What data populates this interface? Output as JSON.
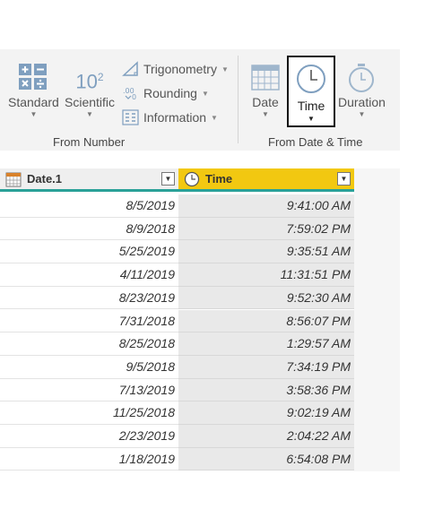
{
  "ribbon": {
    "from_number": {
      "group_label": "From Number",
      "standard_label": "Standard",
      "scientific_label": "Scientific",
      "scientific_icon_text": "10",
      "scientific_icon_sup": "2",
      "trigonometry_label": "Trigonometry",
      "rounding_label": "Rounding",
      "information_label": "Information"
    },
    "from_date_time": {
      "group_label": "From Date & Time",
      "date_label": "Date",
      "time_label": "Time",
      "duration_label": "Duration"
    }
  },
  "table": {
    "columns": [
      {
        "label": "Date.1",
        "icon": "calendar-icon"
      },
      {
        "label": "Time",
        "icon": "clock-icon"
      }
    ],
    "rows": [
      {
        "date": "8/5/2019",
        "time": "9:41:00 AM"
      },
      {
        "date": "8/9/2018",
        "time": "7:59:02 PM"
      },
      {
        "date": "5/25/2019",
        "time": "9:35:51 AM"
      },
      {
        "date": "4/11/2019",
        "time": "11:31:51 PM"
      },
      {
        "date": "8/23/2019",
        "time": "9:52:30 AM"
      },
      {
        "date": "7/31/2018",
        "time": "8:56:07 PM"
      },
      {
        "date": "8/25/2018",
        "time": "1:29:57 AM"
      },
      {
        "date": "9/5/2018",
        "time": "7:34:19 PM"
      },
      {
        "date": "7/13/2019",
        "time": "3:58:36 PM"
      },
      {
        "date": "11/25/2018",
        "time": "9:02:19 AM"
      },
      {
        "date": "2/23/2019",
        "time": "2:04:22 AM"
      },
      {
        "date": "1/18/2019",
        "time": "6:54:08 PM"
      }
    ]
  },
  "colors": {
    "accent_header": "#f2c811",
    "teal_underline": "#2aa198",
    "icon_blue": "#7f9fbf"
  }
}
